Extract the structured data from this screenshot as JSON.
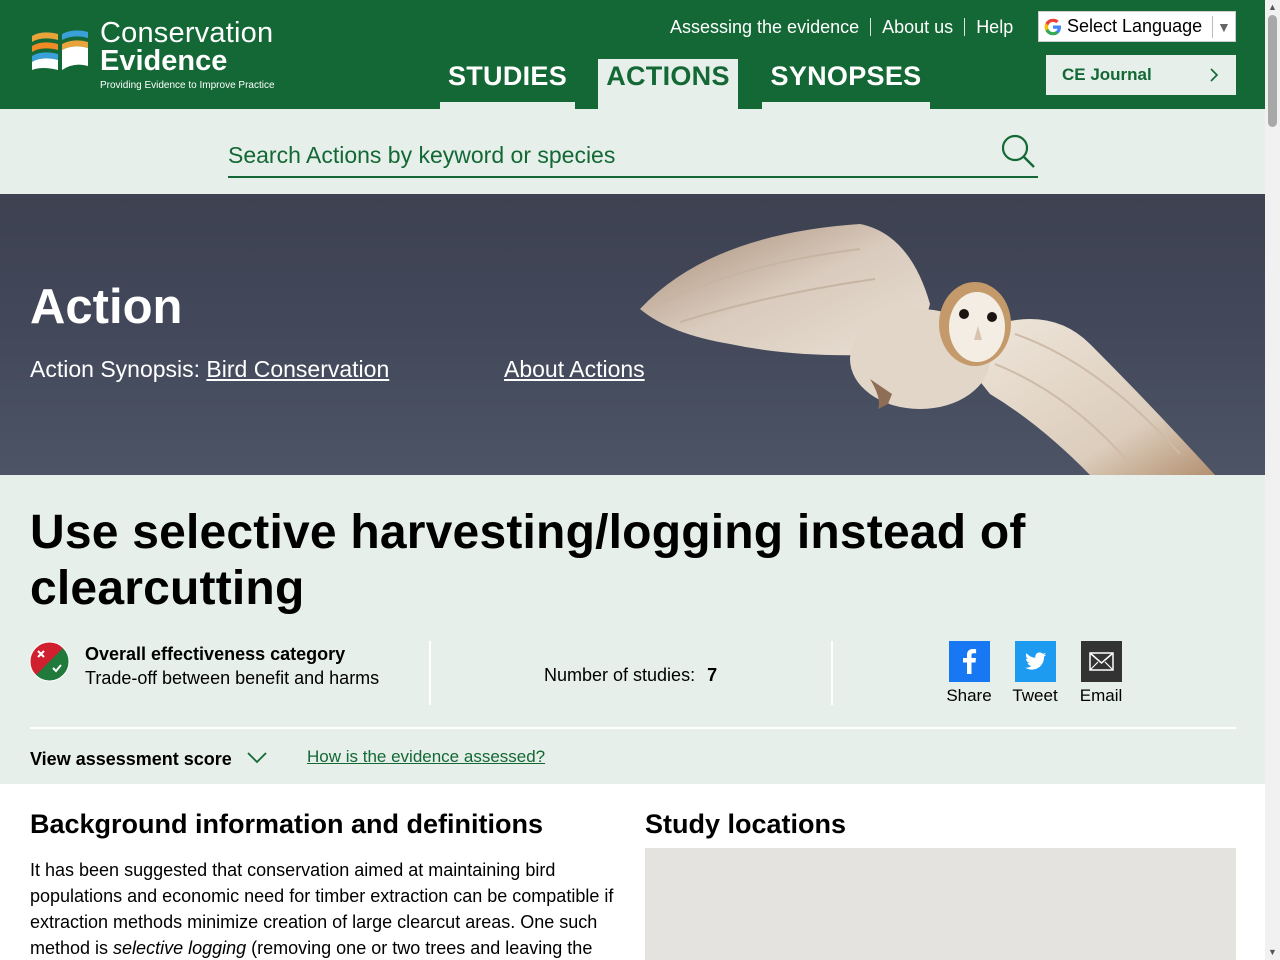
{
  "header": {
    "logo_line1": "Conservation",
    "logo_line2": "Evidence",
    "logo_tagline": "Providing Evidence to Improve Practice",
    "top_links": [
      "Assessing the evidence",
      "About us",
      "Help"
    ],
    "language_label": "Select Language",
    "nav_tabs": [
      {
        "label": "STUDIES",
        "active": false
      },
      {
        "label": "ACTIONS",
        "active": true
      },
      {
        "label": "SYNOPSES",
        "active": false
      }
    ],
    "journal_button": "CE Journal"
  },
  "search": {
    "placeholder": "Search Actions by keyword or species",
    "icon": "search-icon"
  },
  "hero": {
    "title": "Action",
    "synopsis_prefix": "Action Synopsis:",
    "synopsis_link": "Bird Conservation",
    "about_link": "About Actions"
  },
  "action": {
    "title": "Use selective harvesting/logging instead of clearcutting",
    "effectiveness_heading": "Overall effectiveness category",
    "effectiveness_value": "Trade-off between benefit and harms",
    "studies_label": "Number of studies:",
    "studies_count": "7",
    "share_buttons": [
      "Share",
      "Tweet",
      "Email"
    ],
    "assessment_toggle": "View assessment score",
    "assessment_link": "How is the evidence assessed?"
  },
  "background": {
    "heading": "Background information and definitions",
    "text_before": "It has been suggested that conservation aimed at maintaining bird populations and economic need for timber extraction can be compatible if extraction methods minimize creation of large clearcut areas. One such method is ",
    "text_italic": "selective logging",
    "text_after": " (removing one or two trees and leaving the"
  },
  "locations": {
    "heading": "Study locations"
  },
  "colors": {
    "brand_green": "#136835",
    "band_light": "#e6efea",
    "facebook": "#1877f2",
    "twitter": "#1d9bf0"
  }
}
